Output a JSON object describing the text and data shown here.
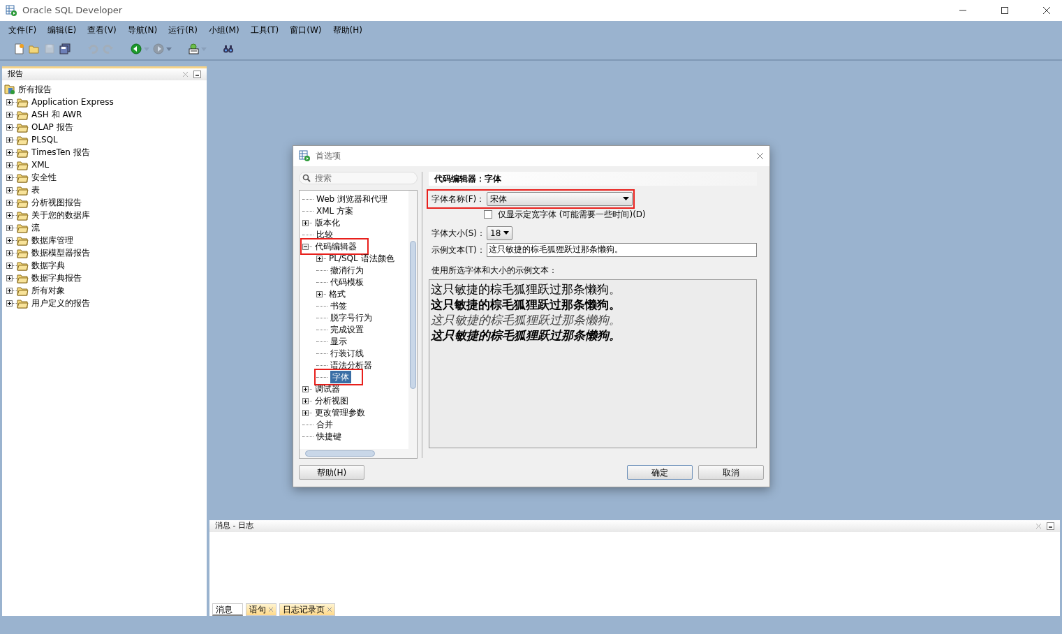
{
  "window": {
    "title": "Oracle SQL Developer"
  },
  "menu": [
    "文件(F)",
    "编辑(E)",
    "查看(V)",
    "导航(N)",
    "运行(R)",
    "小组(M)",
    "工具(T)",
    "窗口(W)",
    "帮助(H)"
  ],
  "toolbar": [
    {
      "kind": "new",
      "disabled": false,
      "dropdown": false
    },
    {
      "kind": "open",
      "disabled": false,
      "dropdown": false
    },
    {
      "kind": "save",
      "disabled": true,
      "dropdown": false
    },
    {
      "kind": "save-all",
      "disabled": false,
      "dropdown": false
    },
    {
      "kind": "undo",
      "disabled": true,
      "dropdown": false
    },
    {
      "kind": "redo",
      "disabled": true,
      "dropdown": false
    },
    {
      "kind": "back",
      "disabled": false,
      "dropdown": true
    },
    {
      "kind": "forward",
      "disabled": true,
      "dropdown": true
    },
    {
      "kind": "sql",
      "disabled": false,
      "dropdown": true
    },
    {
      "kind": "find",
      "disabled": false,
      "dropdown": false
    }
  ],
  "reports": {
    "title": "报告",
    "root": "所有报告",
    "items": [
      {
        "label": "Application Express",
        "expanded": false
      },
      {
        "label": "ASH 和 AWR",
        "expanded": false
      },
      {
        "label": "OLAP 报告",
        "expanded": false
      },
      {
        "label": "PLSQL",
        "expanded": false
      },
      {
        "label": "TimesTen 报告",
        "expanded": false
      },
      {
        "label": "XML",
        "expanded": false
      },
      {
        "label": "安全性",
        "expanded": false
      },
      {
        "label": "表",
        "expanded": false
      },
      {
        "label": "分析视图报告",
        "expanded": false
      },
      {
        "label": "关于您的数据库",
        "expanded": false
      },
      {
        "label": "流",
        "expanded": false
      },
      {
        "label": "数据库管理",
        "expanded": false
      },
      {
        "label": "数据模型器报告",
        "expanded": false
      },
      {
        "label": "数据字典",
        "expanded": false
      },
      {
        "label": "数据字典报告",
        "expanded": false
      },
      {
        "label": "所有对象",
        "expanded": false
      },
      {
        "label": "用户定义的报告",
        "expanded": false
      }
    ]
  },
  "preferences": {
    "title": "首选项",
    "search": {
      "placeholder": "搜索"
    },
    "tree": [
      {
        "label": "Web 浏览器和代理",
        "selected": false,
        "highlighted": false
      },
      {
        "label": "XML 方案",
        "selected": false,
        "highlighted": false
      },
      {
        "label": "版本化",
        "selected": false,
        "highlighted": false,
        "expanded": false
      },
      {
        "label": "比较",
        "selected": false,
        "highlighted": false
      },
      {
        "label": "代码编辑器",
        "selected": false,
        "highlighted": true,
        "expanded": true,
        "children": [
          {
            "label": "PL/SQL 语法颜色",
            "selected": false,
            "highlighted": false,
            "expanded": false
          },
          {
            "label": "撤消行为",
            "selected": false,
            "highlighted": false
          },
          {
            "label": "代码模板",
            "selected": false,
            "highlighted": false
          },
          {
            "label": "格式",
            "selected": false,
            "highlighted": false,
            "expanded": false
          },
          {
            "label": "书签",
            "selected": false,
            "highlighted": false
          },
          {
            "label": "脱字号行为",
            "selected": false,
            "highlighted": false
          },
          {
            "label": "完成设置",
            "selected": false,
            "highlighted": false
          },
          {
            "label": "显示",
            "selected": false,
            "highlighted": false
          },
          {
            "label": "行装订线",
            "selected": false,
            "highlighted": false
          },
          {
            "label": "语法分析器",
            "selected": false,
            "highlighted": false
          },
          {
            "label": "字体",
            "selected": true,
            "highlighted": true
          }
        ]
      },
      {
        "label": "调试器",
        "selected": false,
        "highlighted": false,
        "expanded": false
      },
      {
        "label": "分析视图",
        "selected": false,
        "highlighted": false,
        "expanded": false
      },
      {
        "label": "更改管理参数",
        "selected": false,
        "highlighted": false,
        "expanded": false
      },
      {
        "label": "合并",
        "selected": false,
        "highlighted": false
      },
      {
        "label": "快捷键",
        "selected": false,
        "highlighted": false
      }
    ],
    "heading": "代码编辑器：字体",
    "font_name": {
      "label": "字体名称(F)：",
      "value": "宋体",
      "highlighted": true
    },
    "fixed_width_only": {
      "label": "仅显示定宽字体 (可能需要一些时间)(D)",
      "checked": false
    },
    "font_size": {
      "label": "字体大小(S)：",
      "value": "18"
    },
    "sample_text": {
      "label": "示例文本(T)：",
      "value": "这只敏捷的棕毛狐狸跃过那条懒狗。"
    },
    "preview": {
      "caption": "使用所选字体和大小的示例文本：",
      "lines": [
        {
          "text": "这只敏捷的棕毛狐狸跃过那条懒狗。",
          "kind": "regular"
        },
        {
          "text": "这只敏捷的棕毛狐狸跃过那条懒狗。",
          "kind": "bold"
        },
        {
          "text": "这只敏捷的棕毛狐狸跃过那条懒狗。",
          "kind": "italic"
        },
        {
          "text": "这只敏捷的棕毛狐狸跃过那条懒狗。",
          "kind": "bold-italic"
        }
      ]
    },
    "buttons": {
      "help": "帮助(H)",
      "ok": "确定",
      "cancel": "取消"
    }
  },
  "log": {
    "title": "消息 - 日志",
    "tabs": [
      {
        "label": "消息",
        "selected": true,
        "closable": false
      },
      {
        "label": "语句",
        "selected": false,
        "closable": true
      },
      {
        "label": "日志记录页",
        "selected": false,
        "closable": true
      }
    ]
  }
}
